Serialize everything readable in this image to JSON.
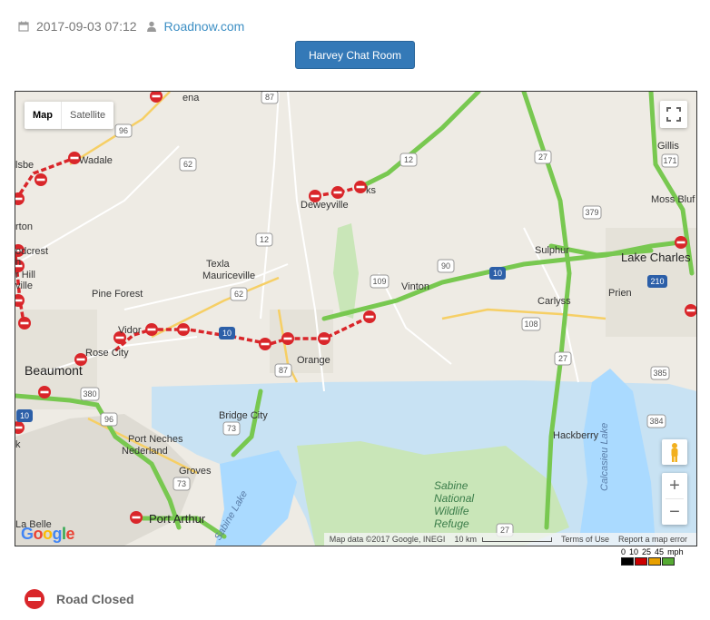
{
  "header": {
    "date": "2017-09-03 07:12",
    "site": "Roadnow.com",
    "chat_button": "Harvey Chat Room"
  },
  "map": {
    "type_map": "Map",
    "type_satellite": "Satellite",
    "google_logo": "Google",
    "attribution": "Map data ©2017 Google, INEGI",
    "scale_label": "10 km",
    "terms": "Terms of Use",
    "report": "Report a map error",
    "zoom_in": "+",
    "zoom_out": "−",
    "places": [
      {
        "id": "ena",
        "text": "ena"
      },
      {
        "id": "wadale",
        "text": "Wadale"
      },
      {
        "id": "isbe",
        "text": "lsbe"
      },
      {
        "id": "deweyville",
        "text": "Deweyville"
      },
      {
        "id": "ks",
        "text": "ks"
      },
      {
        "id": "gillis",
        "text": "Gillis"
      },
      {
        "id": "moss-bluff",
        "text": "Moss Bluf"
      },
      {
        "id": "rton",
        "text": "rton"
      },
      {
        "id": "odcrest",
        "text": "odcrest"
      },
      {
        "id": "n",
        "text": "n"
      },
      {
        "id": "r-hill",
        "text": "r Hill"
      },
      {
        "id": "ville",
        "text": "ville"
      },
      {
        "id": "texla",
        "text": "Texla"
      },
      {
        "id": "mauriceville",
        "text": "Mauriceville"
      },
      {
        "id": "pine-forest",
        "text": "Pine Forest"
      },
      {
        "id": "sulphur",
        "text": "Sulphur"
      },
      {
        "id": "lake-charles",
        "text": "Lake Charles"
      },
      {
        "id": "vinton",
        "text": "Vinton"
      },
      {
        "id": "carlyss",
        "text": "Carlyss"
      },
      {
        "id": "prien",
        "text": "Prien"
      },
      {
        "id": "vidor",
        "text": "Vidor"
      },
      {
        "id": "rose-city",
        "text": "Rose City"
      },
      {
        "id": "beaumont",
        "text": "Beaumont"
      },
      {
        "id": "orange",
        "text": "Orange"
      },
      {
        "id": "bridge-city",
        "text": "Bridge City"
      },
      {
        "id": "port-neches",
        "text": "Port Neches"
      },
      {
        "id": "nederland",
        "text": "Nederland"
      },
      {
        "id": "groves",
        "text": "Groves"
      },
      {
        "id": "hackberry",
        "text": "Hackberry"
      },
      {
        "id": "k",
        "text": "k"
      },
      {
        "id": "sabine-nwr",
        "text": "Sabine National Wildlife Refuge"
      },
      {
        "id": "calcasieu-lake",
        "text": "Calcasieu Lake"
      },
      {
        "id": "sabine-lake",
        "text": "Sabine Lake"
      },
      {
        "id": "la-belle",
        "text": "La Belle"
      },
      {
        "id": "port-arthur",
        "text": "Port Arthur"
      }
    ],
    "shields": [
      "96",
      "87",
      "12",
      "12",
      "27",
      "171",
      "62",
      "12",
      "379",
      "62",
      "90",
      "109",
      "10",
      "210",
      "87",
      "10",
      "108",
      "27",
      "385",
      "380",
      "96",
      "87",
      "73",
      "384",
      "73",
      "27",
      "10"
    ]
  },
  "speed_legend": {
    "values": [
      "0",
      "10",
      "25",
      "45",
      "mph"
    ],
    "colors": [
      "#000000",
      "#cc0000",
      "#e8a000",
      "#55aa33"
    ]
  },
  "closure_legend": {
    "label": "Road Closed",
    "color": "#d9262a"
  }
}
